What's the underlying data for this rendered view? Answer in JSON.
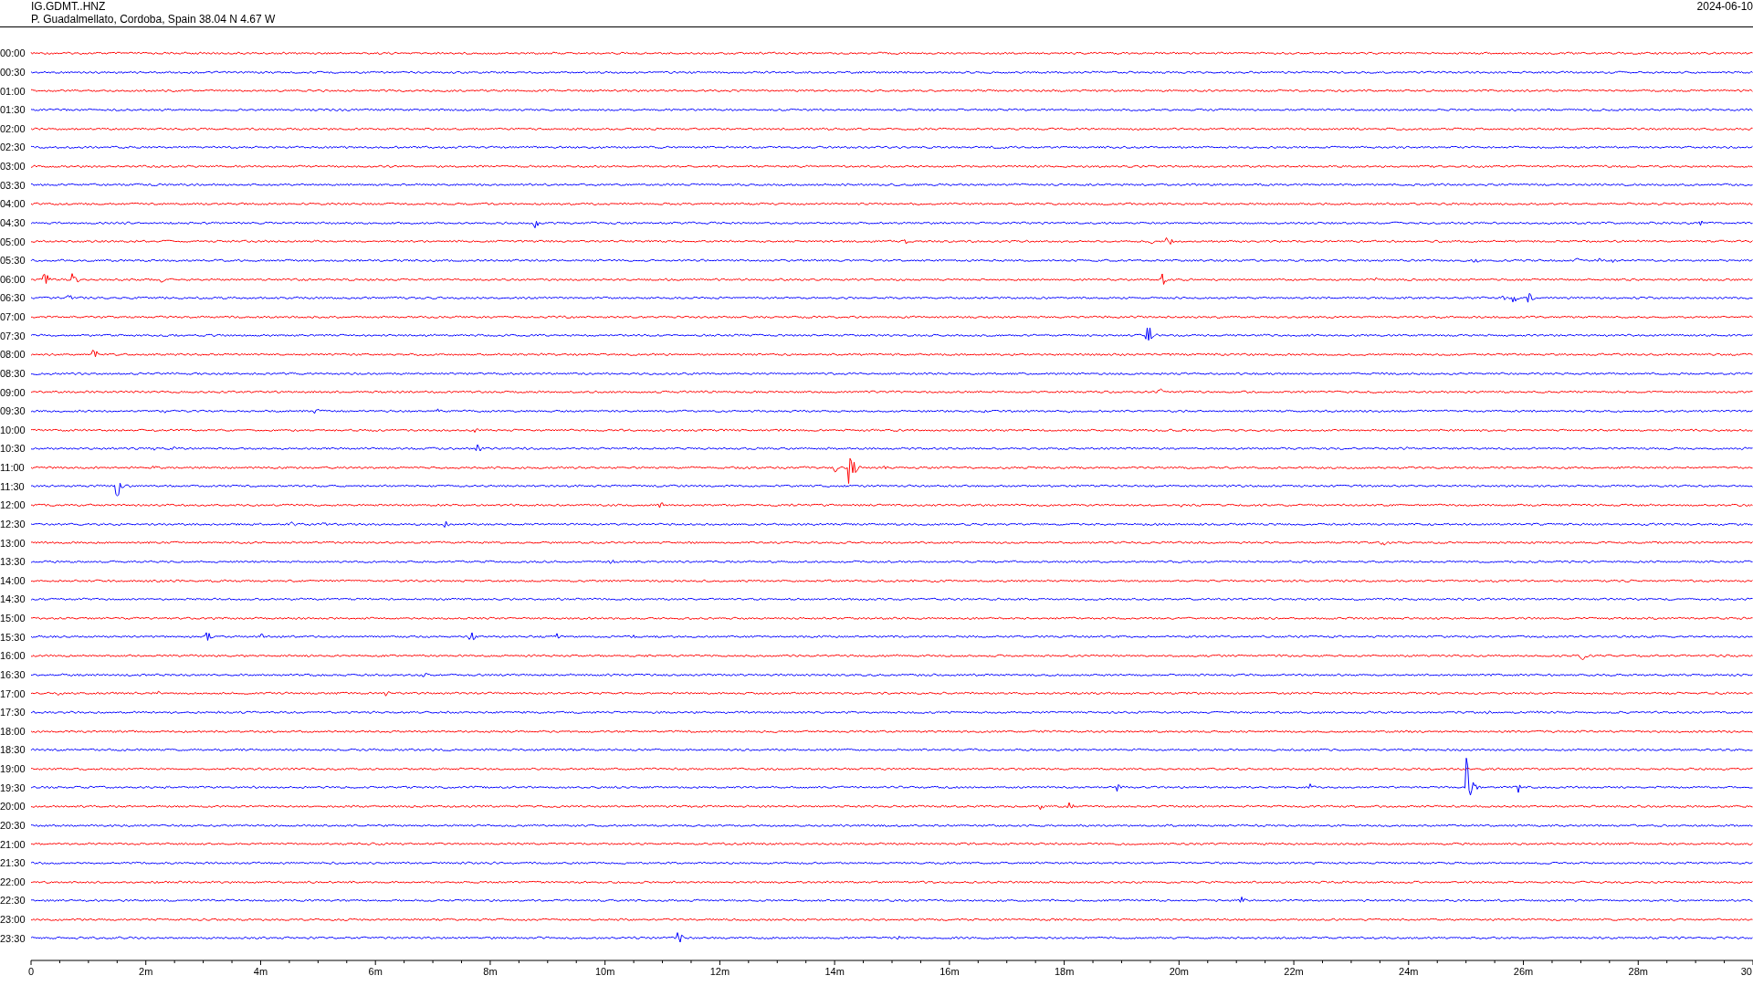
{
  "header": {
    "station": "IG.GDMT..HNZ",
    "location": "P. Guadalmellato, Cordoba, Spain  38.04 N 4.67 W",
    "date": "2024-06-10"
  },
  "rows": [
    {
      "label": "00:00",
      "color": "#ff0000"
    },
    {
      "label": "00:30",
      "color": "#0000ff"
    },
    {
      "label": "01:00",
      "color": "#ff0000"
    },
    {
      "label": "01:30",
      "color": "#0000ff"
    },
    {
      "label": "02:00",
      "color": "#ff0000"
    },
    {
      "label": "02:30",
      "color": "#0000ff"
    },
    {
      "label": "03:00",
      "color": "#ff0000"
    },
    {
      "label": "03:30",
      "color": "#0000ff"
    },
    {
      "label": "04:00",
      "color": "#ff0000"
    },
    {
      "label": "04:30",
      "color": "#0000ff"
    },
    {
      "label": "05:00",
      "color": "#ff0000"
    },
    {
      "label": "05:30",
      "color": "#0000ff"
    },
    {
      "label": "06:00",
      "color": "#ff0000"
    },
    {
      "label": "06:30",
      "color": "#0000ff"
    },
    {
      "label": "07:00",
      "color": "#ff0000"
    },
    {
      "label": "07:30",
      "color": "#0000ff"
    },
    {
      "label": "08:00",
      "color": "#ff0000"
    },
    {
      "label": "08:30",
      "color": "#0000ff"
    },
    {
      "label": "09:00",
      "color": "#ff0000"
    },
    {
      "label": "09:30",
      "color": "#0000ff"
    },
    {
      "label": "10:00",
      "color": "#ff0000"
    },
    {
      "label": "10:30",
      "color": "#0000ff"
    },
    {
      "label": "11:00",
      "color": "#ff0000"
    },
    {
      "label": "11:30",
      "color": "#0000ff"
    },
    {
      "label": "12:00",
      "color": "#ff0000"
    },
    {
      "label": "12:30",
      "color": "#0000ff"
    },
    {
      "label": "13:00",
      "color": "#ff0000"
    },
    {
      "label": "13:30",
      "color": "#0000ff"
    },
    {
      "label": "14:00",
      "color": "#ff0000"
    },
    {
      "label": "14:30",
      "color": "#0000ff"
    },
    {
      "label": "15:00",
      "color": "#ff0000"
    },
    {
      "label": "15:30",
      "color": "#0000ff"
    },
    {
      "label": "16:00",
      "color": "#ff0000"
    },
    {
      "label": "16:30",
      "color": "#0000ff"
    },
    {
      "label": "17:00",
      "color": "#ff0000"
    },
    {
      "label": "17:30",
      "color": "#0000ff"
    },
    {
      "label": "18:00",
      "color": "#ff0000"
    },
    {
      "label": "18:30",
      "color": "#0000ff"
    },
    {
      "label": "19:00",
      "color": "#ff0000"
    },
    {
      "label": "19:30",
      "color": "#0000ff"
    },
    {
      "label": "20:00",
      "color": "#ff0000"
    },
    {
      "label": "20:30",
      "color": "#0000ff"
    },
    {
      "label": "21:00",
      "color": "#ff0000"
    },
    {
      "label": "21:30",
      "color": "#0000ff"
    },
    {
      "label": "22:00",
      "color": "#ff0000"
    },
    {
      "label": "22:30",
      "color": "#0000ff"
    },
    {
      "label": "23:00",
      "color": "#ff0000"
    },
    {
      "label": "23:30",
      "color": "#0000ff"
    }
  ],
  "axis": {
    "ticks": [
      "0",
      "2m",
      "4m",
      "6m",
      "8m",
      "10m",
      "12m",
      "14m",
      "16m",
      "18m",
      "20m",
      "22m",
      "24m",
      "26m",
      "28m",
      "30"
    ]
  }
}
